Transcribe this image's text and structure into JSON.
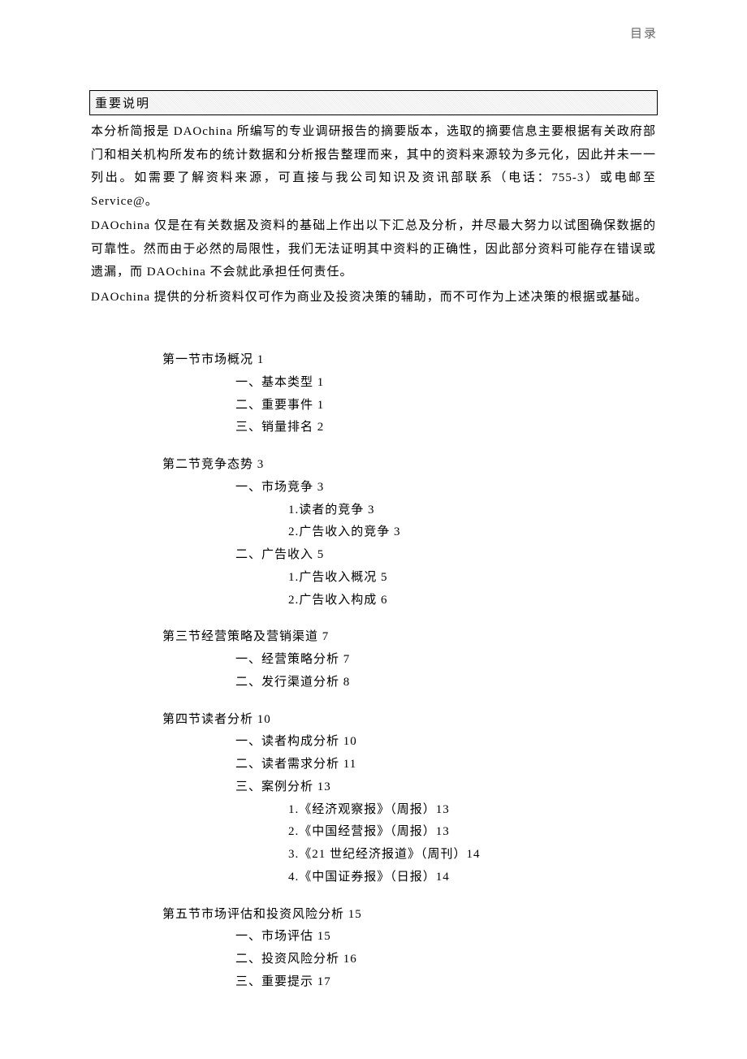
{
  "header": {
    "label": "目录"
  },
  "notice": {
    "title": "重要说明",
    "paragraphs": [
      "本分析简报是 DAOchina 所编写的专业调研报告的摘要版本，选取的摘要信息主要根据有关政府部门和相关机构所发布的统计数据和分析报告整理而来，其中的资料来源较为多元化，因此并未一一列出。如需要了解资料来源，可直接与我公司知识及资讯部联系（电话：755-3）或电邮至 Service@。",
      "DAOchina 仅是在有关数据及资料的基础上作出以下汇总及分析，并尽最大努力以试图确保数据的可靠性。然而由于必然的局限性，我们无法证明其中资料的正确性，因此部分资料可能存在错误或遗漏，而 DAOchina 不会就此承担任何责任。",
      "DAOchina 提供的分析资料仅可作为商业及投资决策的辅助，而不可作为上述决策的根据或基础。"
    ]
  },
  "toc": {
    "sections": [
      {
        "title": "第一节市场概况 1",
        "items": [
          {
            "level": 2,
            "text": "一、基本类型 1"
          },
          {
            "level": 2,
            "text": "二、重要事件 1"
          },
          {
            "level": 2,
            "text": "三、销量排名 2"
          }
        ]
      },
      {
        "title": "第二节竞争态势 3",
        "items": [
          {
            "level": 2,
            "text": "一、市场竞争 3"
          },
          {
            "level": 3,
            "text": "1.读者的竞争 3"
          },
          {
            "level": 3,
            "text": "2.广告收入的竞争 3"
          },
          {
            "level": 2,
            "text": "二、广告收入 5"
          },
          {
            "level": 3,
            "text": "1.广告收入概况 5"
          },
          {
            "level": 3,
            "text": "2.广告收入构成 6"
          }
        ]
      },
      {
        "title": "第三节经营策略及营销渠道 7",
        "items": [
          {
            "level": 2,
            "text": "一、经营策略分析 7"
          },
          {
            "level": 2,
            "text": "二、发行渠道分析 8"
          }
        ]
      },
      {
        "title": "第四节读者分析 10",
        "items": [
          {
            "level": 2,
            "text": "一、读者构成分析 10"
          },
          {
            "level": 2,
            "text": "二、读者需求分析 11"
          },
          {
            "level": 2,
            "text": "三、案例分析 13"
          },
          {
            "level": 3,
            "text": "1.《经济观察报》（周报）13"
          },
          {
            "level": 3,
            "text": "2.《中国经营报》（周报）13"
          },
          {
            "level": 3,
            "text": "3.《21 世纪经济报道》（周刊）14"
          },
          {
            "level": 3,
            "text": "4.《中国证券报》（日报）14"
          }
        ]
      },
      {
        "title": "第五节市场评估和投资风险分析 15",
        "items": [
          {
            "level": 2,
            "text": "一、市场评估 15"
          },
          {
            "level": 2,
            "text": "二、投资风险分析 16"
          },
          {
            "level": 2,
            "text": "三、重要提示 17"
          }
        ]
      }
    ]
  }
}
